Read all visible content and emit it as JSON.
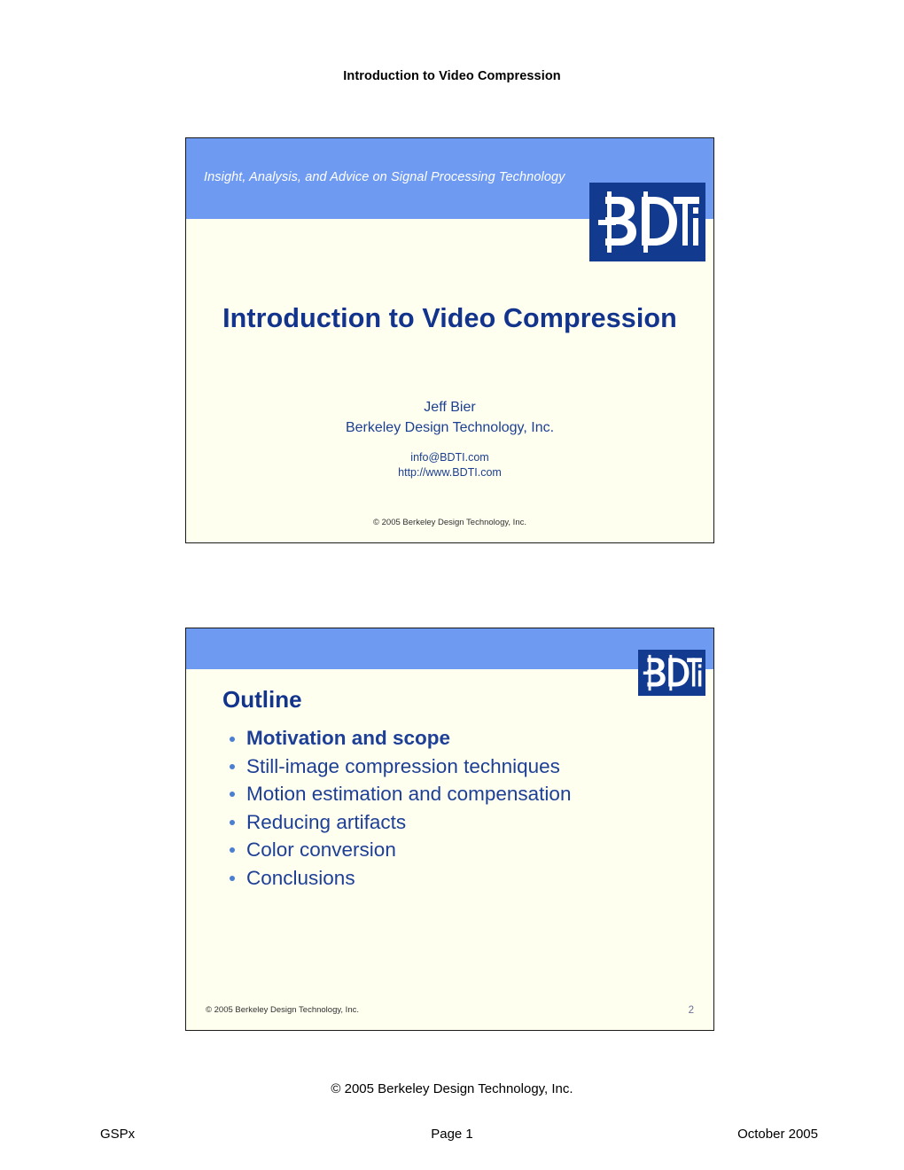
{
  "page": {
    "running_head": "Introduction to Video Compression",
    "copyright_center": "©  2005 Berkeley Design Technology, Inc.",
    "footer_left": "GSPx",
    "footer_center": "Page 1",
    "footer_right": "October 2005"
  },
  "colors": {
    "banner_blue": "#6e9af2",
    "logo_navy": "#123a8f",
    "slide_background": "#fffff0",
    "heading_navy": "#13348c",
    "body_navy": "#1d3f96",
    "bullet_marker": "#4a7fd4"
  },
  "slides": [
    {
      "number": 1,
      "tagline": "Insight, Analysis, and Advice on Signal Processing Technology",
      "logo_text": "BDTi",
      "title": "Introduction to Video Compression",
      "author_name": "Jeff Bier",
      "author_company": "Berkeley Design Technology, Inc.",
      "contact_email": "info@BDTI.com",
      "contact_url": "http://www.BDTI.com",
      "copyright": "© 2005 Berkeley Design Technology, Inc."
    },
    {
      "number": 2,
      "logo_text": "BDTi",
      "title": "Outline",
      "bullets": [
        {
          "label": "Motivation and scope",
          "emphasis": true
        },
        {
          "label": "Still-image compression techniques",
          "emphasis": false
        },
        {
          "label": "Motion estimation and compensation",
          "emphasis": false
        },
        {
          "label": "Reducing artifacts",
          "emphasis": false
        },
        {
          "label": "Color conversion",
          "emphasis": false
        },
        {
          "label": "Conclusions",
          "emphasis": false
        }
      ],
      "copyright": "© 2005 Berkeley Design Technology, Inc.",
      "page_number": "2"
    }
  ]
}
